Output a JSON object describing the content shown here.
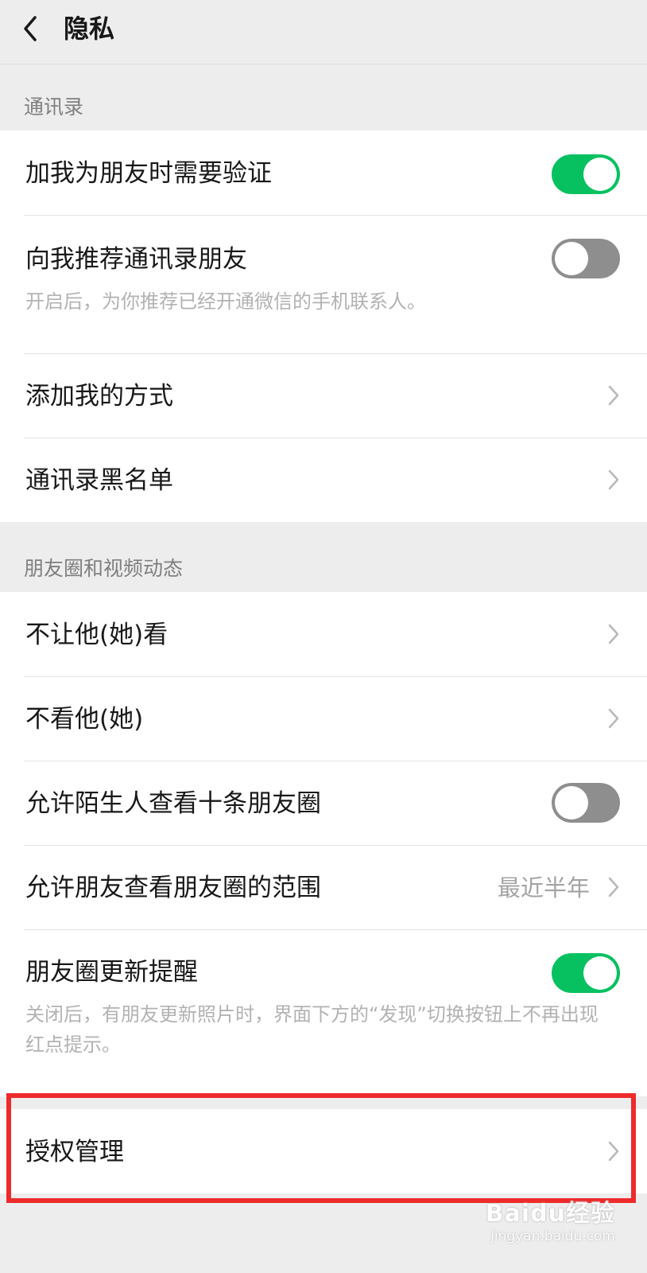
{
  "header": {
    "title": "隐私"
  },
  "sections": {
    "contacts": {
      "label": "通讯录",
      "items": [
        {
          "label": "加我为朋友时需要验证",
          "toggle": "on"
        },
        {
          "label": "向我推荐通讯录朋友",
          "desc": "开启后，为你推荐已经开通微信的手机联系人。",
          "toggle": "off"
        },
        {
          "label": "添加我的方式"
        },
        {
          "label": "通讯录黑名单"
        }
      ]
    },
    "moments": {
      "label": "朋友圈和视频动态",
      "items": [
        {
          "label": "不让他(她)看"
        },
        {
          "label": "不看他(她)"
        },
        {
          "label": "允许陌生人查看十条朋友圈",
          "toggle": "off"
        },
        {
          "label": "允许朋友查看朋友圈的范围",
          "value": "最近半年"
        },
        {
          "label": "朋友圈更新提醒",
          "desc": "关闭后，有朋友更新照片时，界面下方的“发现”切换按钮上不再出现红点提示。",
          "toggle": "on"
        }
      ]
    },
    "auth": {
      "items": [
        {
          "label": "授权管理"
        }
      ]
    }
  },
  "watermark": {
    "brand": "Baidu经验",
    "url": "jingyan.baidu.com"
  },
  "colors": {
    "toggle_on": "#07c160",
    "toggle_off": "#8e8e8e",
    "highlight": "#ee2b2b"
  }
}
